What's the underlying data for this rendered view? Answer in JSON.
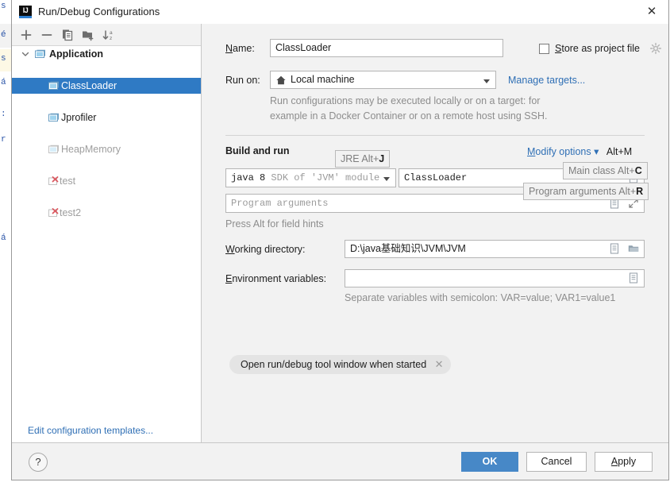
{
  "window": {
    "title": "Run/Debug Configurations",
    "app_icon": "intellij-idea-icon",
    "close_label": "✕"
  },
  "background": {
    "lines": [
      "s",
      "é",
      "s",
      "á",
      ":",
      "r",
      "á"
    ]
  },
  "toolbar": {
    "buttons": [
      {
        "name": "add-configuration-button",
        "icon": "plus-icon",
        "label": "+"
      },
      {
        "name": "remove-configuration-button",
        "icon": "minus-icon",
        "label": "−"
      },
      {
        "name": "copy-configuration-button",
        "icon": "copy-icon",
        "label": "Copy"
      },
      {
        "name": "new-folder-button",
        "icon": "new-folder-icon",
        "label": "New Folder"
      },
      {
        "name": "sort-configurations-button",
        "icon": "sort-alphabetical-icon",
        "label": "Sort"
      }
    ]
  },
  "tree": {
    "items": [
      {
        "label": "Application",
        "type": "group",
        "icon": "application-icon",
        "selected": false,
        "dim": false,
        "error": false
      },
      {
        "label": "ClassLoader",
        "type": "config",
        "icon": "application-icon",
        "selected": true,
        "dim": false,
        "error": false
      },
      {
        "label": "Jprofiler",
        "type": "config",
        "icon": "application-icon",
        "selected": false,
        "dim": false,
        "error": false
      },
      {
        "label": "HeapMemory",
        "type": "config",
        "icon": "application-icon",
        "selected": false,
        "dim": true,
        "error": false
      },
      {
        "label": "test",
        "type": "config",
        "icon": "error-config-icon",
        "selected": false,
        "dim": true,
        "error": true
      },
      {
        "label": "test2",
        "type": "config",
        "icon": "error-config-icon",
        "selected": false,
        "dim": true,
        "error": true
      }
    ],
    "edit_templates_link": "Edit configuration templates..."
  },
  "form": {
    "name_label": "Name:",
    "name_label_mnemonic": "N",
    "name_value": "ClassLoader",
    "store_as_project_file_label": "Store as project file",
    "store_as_project_file_mnemonic": "S",
    "store_as_project_file_checked": false,
    "store_gear_icon": "gear-icon",
    "run_on_label": "Run on:",
    "run_on_value": "Local machine",
    "run_on_icon": "home-icon",
    "manage_targets_link": "Manage targets...",
    "run_on_description_line1": "Run configurations may be executed locally or on a target: for",
    "run_on_description_line2": "example in a Docker Container or on a remote host using SSH.",
    "build_and_run_title": "Build and run",
    "modify_options_link": "Modify options",
    "modify_options_shortcut": "Alt+M",
    "modify_options_mnemonic": "M",
    "jre_value": "java 8",
    "jre_suffix": "SDK of 'JVM' module",
    "main_class_value": "ClassLoader",
    "program_arguments_placeholder": "Program arguments",
    "press_alt_hint": "Press Alt for field hints",
    "working_directory_label": "Working directory:",
    "working_directory_mnemonic": "W",
    "working_directory_value": "D:\\java基础知识\\JVM\\JVM",
    "environment_variables_label": "Environment variables:",
    "environment_variables_mnemonic": "E",
    "environment_variables_value": "",
    "environment_variables_hint": "Separate variables with semicolon: VAR=value; VAR1=value1",
    "chip_label": "Open run/debug tool window when started",
    "chip_close": "✕"
  },
  "tooltips": [
    {
      "name": "jre-alt-hint",
      "text": "JRE Alt+",
      "key": "J"
    },
    {
      "name": "main-class-alt-hint",
      "text": "Main class Alt+",
      "key": "C"
    },
    {
      "name": "program-arguments-alt-hint",
      "text": "Program arguments Alt+",
      "key": "R"
    }
  ],
  "footer": {
    "help_label": "?",
    "ok_label": "OK",
    "cancel_label": "Cancel",
    "apply_label": "Apply",
    "apply_mnemonic": "A"
  },
  "colors": {
    "selection_blue": "#2f7ac4",
    "primary_button": "#4788c7",
    "link_blue": "#2f6fb5",
    "panel_bg": "#f2f2f2",
    "error_red": "#db5860"
  }
}
